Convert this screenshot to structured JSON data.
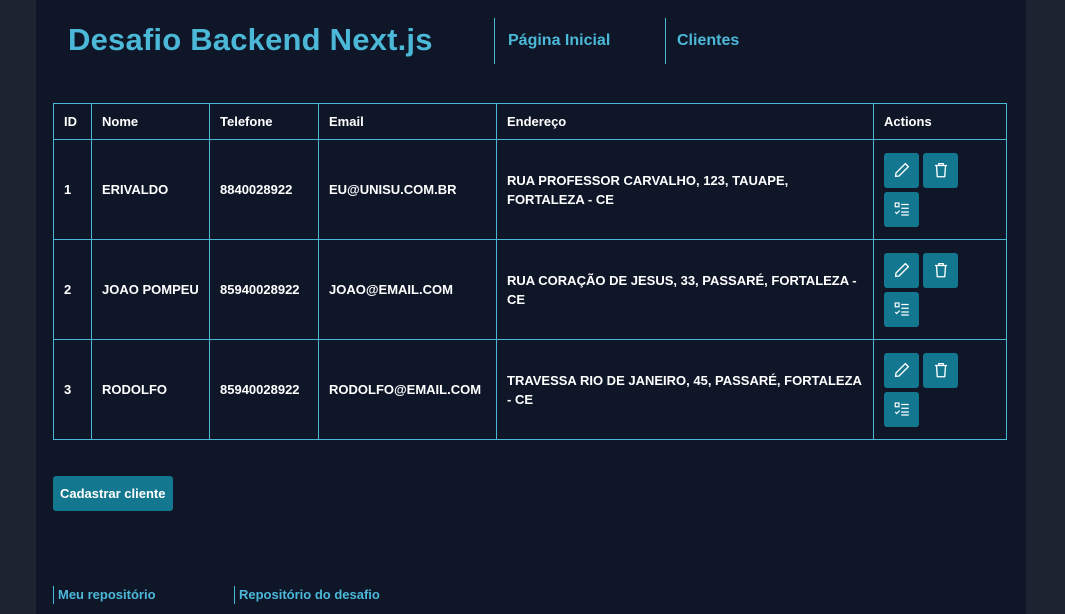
{
  "header": {
    "title": "Desafio Backend Next.js",
    "nav": [
      {
        "label": "Página Inicial"
      },
      {
        "label": "Clientes"
      }
    ]
  },
  "table": {
    "columns": [
      "ID",
      "Nome",
      "Telefone",
      "Email",
      "Endereço",
      "Actions"
    ],
    "rows": [
      {
        "id": "1",
        "nome": "ERIVALDO",
        "telefone": "8840028922",
        "email": "EU@UNISU.COM.BR",
        "endereco": "RUA PROFESSOR CARVALHO, 123, TAUAPE, FORTALEZA - CE"
      },
      {
        "id": "2",
        "nome": "JOAO POMPEU",
        "telefone": "85940028922",
        "email": "JOAO@EMAIL.COM",
        "endereco": "RUA CORAÇÃO DE JESUS, 33, PASSARÉ, FORTALEZA - CE"
      },
      {
        "id": "3",
        "nome": "RODOLFO",
        "telefone": "85940028922",
        "email": "RODOLFO@EMAIL.COM",
        "endereco": "TRAVESSA RIO DE JANEIRO, 45, PASSARÉ, FORTALEZA - CE"
      }
    ],
    "action_icons": [
      "pencil-icon",
      "trash-icon",
      "checklist-icon"
    ]
  },
  "buttons": {
    "register_label": "Cadastrar cliente"
  },
  "footer": {
    "links": [
      {
        "label": "Meu repositório"
      },
      {
        "label": "Repositório do desafio"
      }
    ]
  },
  "colors": {
    "background": "#0e1628",
    "outer_background": "#1c2432",
    "accent": "#4cb8d8",
    "button": "#13778f",
    "text": "#ffffff"
  }
}
